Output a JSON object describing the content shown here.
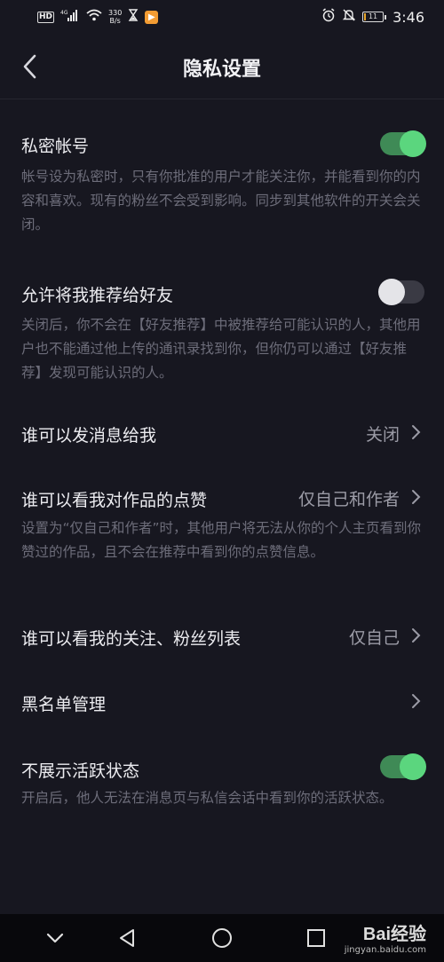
{
  "status_bar": {
    "hd": "HD",
    "signal": "4G",
    "net_speed": "330",
    "net_unit": "B/s",
    "battery": "11",
    "time": "3:46",
    "battery_level": 0.11
  },
  "nav": {
    "title": "隐私设置"
  },
  "settings": {
    "private_account": {
      "title": "私密帐号",
      "enabled": true,
      "desc": "帐号设为私密时，只有你批准的用户才能关注你，并能看到你的内容和喜欢。现有的粉丝不会受到影响。同步到其他软件的开关会关闭。"
    },
    "recommend_friends": {
      "title": "允许将我推荐给好友",
      "enabled": false,
      "desc": "关闭后，你不会在【好友推荐】中被推荐给可能认识的人，其他用户也不能通过他上传的通讯录找到你，但你仍可以通过【好友推荐】发现可能认识的人。"
    },
    "message": {
      "title": "谁可以发消息给我",
      "value": "关闭"
    },
    "likes_visibility": {
      "title": "谁可以看我对作品的点赞",
      "value": "仅自己和作者",
      "desc": "设置为“仅自己和作者”时，其他用户将无法从你的个人主页看到你赞过的作品，且不会在推荐中看到你的点赞信息。"
    },
    "follow_list": {
      "title": "谁可以看我的关注、粉丝列表",
      "value": "仅自己"
    },
    "blacklist": {
      "title": "黑名单管理"
    },
    "hide_active": {
      "title": "不展示活跃状态",
      "enabled": true,
      "desc": "开启后，他人无法在消息页与私信会话中看到你的活跃状态。"
    }
  },
  "watermark": {
    "logo": "Bai经验",
    "url": "jingyan.baidu.com"
  },
  "colors": {
    "toggle_on": "#5bd67e",
    "toggle_track_on": "#3f8a56",
    "background": "#171720",
    "desc": "#6d6d7a"
  }
}
